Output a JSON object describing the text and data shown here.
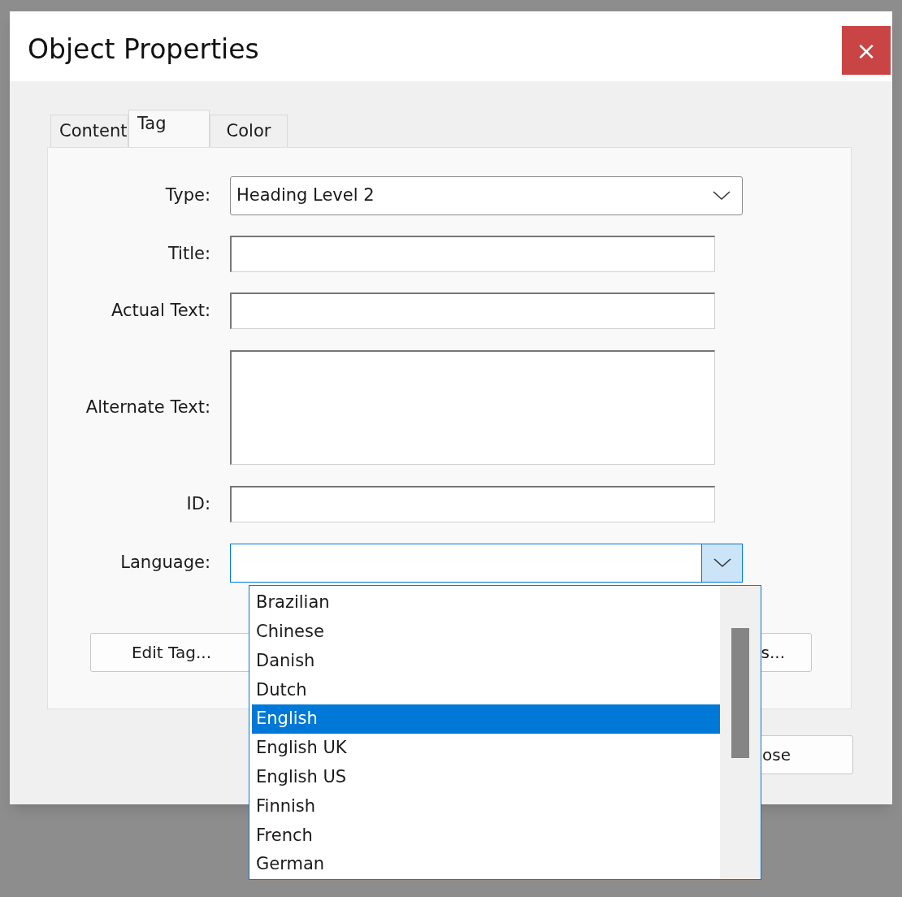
{
  "window": {
    "title": "Object Properties",
    "close": "×"
  },
  "tabs": [
    {
      "label": "Content",
      "selected": false
    },
    {
      "label": "Tag",
      "selected": true
    },
    {
      "label": "Color",
      "selected": false
    }
  ],
  "fields": [
    {
      "label": "Type:",
      "kind": "dropdown",
      "value": "Heading Level 2",
      "expanded": false
    },
    {
      "label": "Title:",
      "kind": "text"
    },
    {
      "label": "Actual Text:",
      "kind": "text"
    },
    {
      "label": "Alternate Text:",
      "kind": "textarea"
    },
    {
      "label": "ID:",
      "kind": "text"
    },
    {
      "label": "Language:",
      "kind": "dropdown",
      "expanded": true
    }
  ],
  "panel_buttons": [
    {
      "label": "Edit Tag..."
    },
    {
      "label": "s..."
    }
  ],
  "footer_button": {
    "label": "ose"
  },
  "language_options": [
    {
      "label": "Brazilian",
      "selected": false
    },
    {
      "label": "Chinese",
      "selected": false
    },
    {
      "label": "Danish",
      "selected": false
    },
    {
      "label": "Dutch",
      "selected": false
    },
    {
      "label": "English",
      "selected": true
    },
    {
      "label": "English UK",
      "selected": false
    },
    {
      "label": "English US",
      "selected": false
    },
    {
      "label": "Finnish",
      "selected": false
    },
    {
      "label": "French",
      "selected": false
    },
    {
      "label": "German",
      "selected": false
    }
  ]
}
